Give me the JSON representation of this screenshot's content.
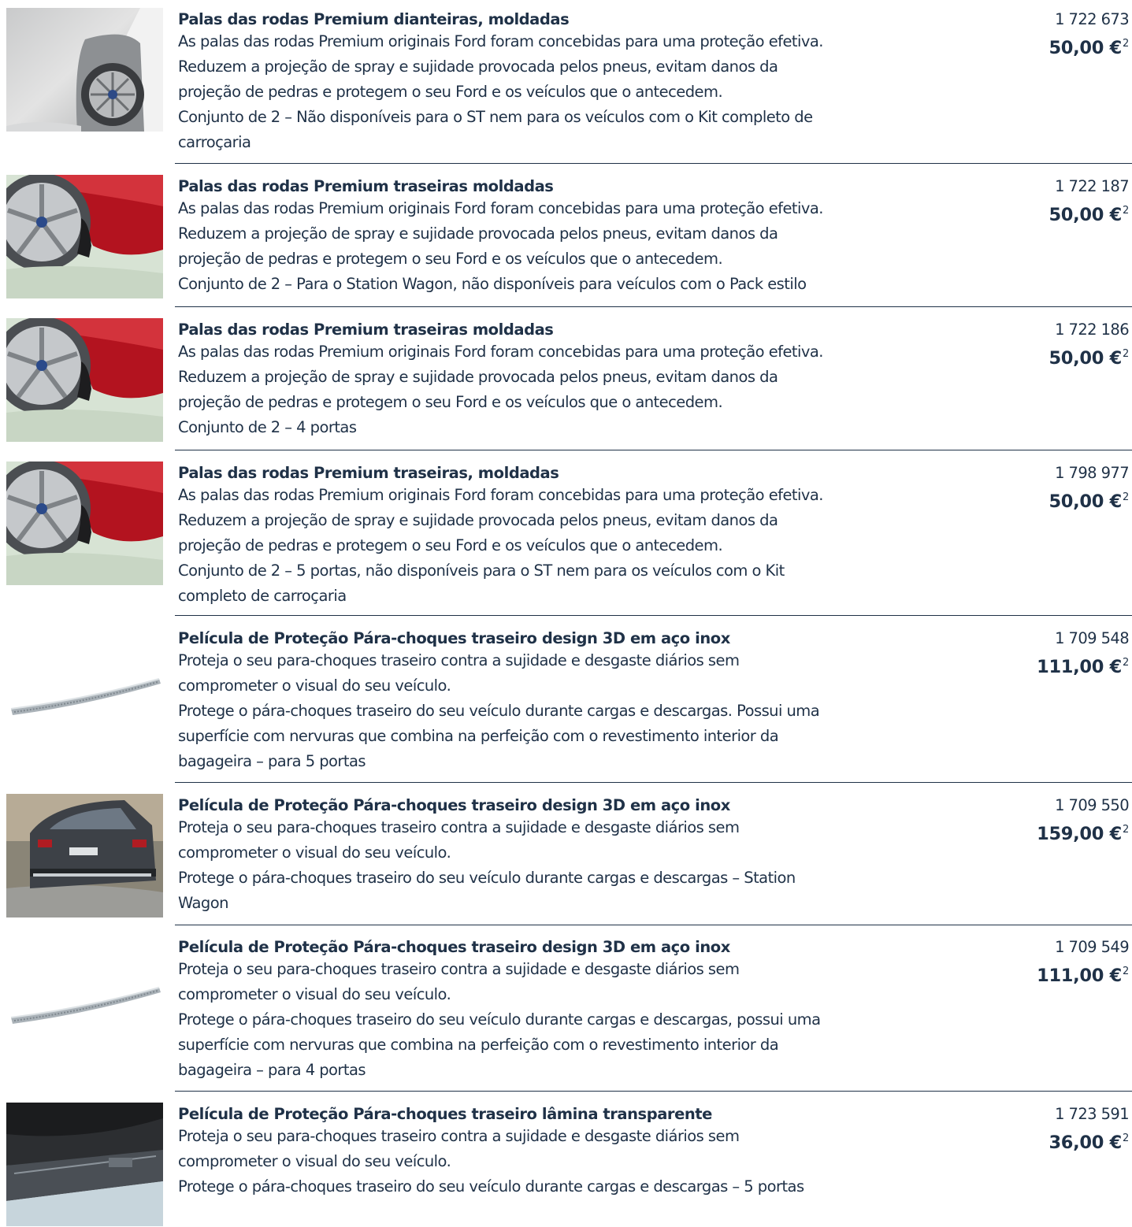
{
  "items": [
    {
      "title": "Palas das rodas Premium dianteiras, moldadas",
      "lines": [
        "As palas das rodas Premium originais Ford foram concebidas para uma proteção efetiva.",
        "Reduzem a projeção de spray e sujidade provocada pelos pneus, evitam danos da",
        "projeção de pedras e protegem o seu Ford e os veículos que o antecedem.",
        "Conjunto de 2 – Não disponíveis para o ST nem para os veículos com o Kit completo de",
        "carroçaria"
      ],
      "code": "1 722 673",
      "price": "50,00 €",
      "footnote": "2",
      "image": "front-wheel-mudflap-silver-car"
    },
    {
      "title": "Palas das rodas Premium traseiras moldadas",
      "lines": [
        "As palas das rodas Premium originais Ford foram concebidas para uma proteção efetiva.",
        "Reduzem a projeção de spray e sujidade provocada pelos pneus, evitam danos da",
        "projeção de pedras e protegem o seu Ford e os veículos que o antecedem.",
        "Conjunto de 2 – Para o Station Wagon, não disponíveis para veículos com o Pack estilo"
      ],
      "code": "1 722 187",
      "price": "50,00 €",
      "footnote": "2",
      "image": "rear-wheel-mudflap-red-car"
    },
    {
      "title": "Palas das rodas Premium traseiras moldadas",
      "lines": [
        "As palas das rodas Premium originais Ford foram concebidas para uma proteção efetiva.",
        "Reduzem a projeção de spray e sujidade provocada pelos pneus, evitam danos da",
        "projeção de pedras e protegem o seu Ford e os veículos que o antecedem.",
        "Conjunto de 2 – 4 portas"
      ],
      "code": "1 722 186",
      "price": "50,00 €",
      "footnote": "2",
      "image": "rear-wheel-mudflap-red-car"
    },
    {
      "title": "Palas das rodas Premium traseiras, moldadas",
      "lines": [
        "As palas das rodas Premium originais Ford foram concebidas para uma proteção efetiva.",
        "Reduzem a projeção de spray e sujidade provocada pelos pneus, evitam danos da",
        "projeção de pedras e protegem o seu Ford e os veículos que o antecedem.",
        "Conjunto de 2 – 5 portas, não disponíveis para o ST nem para os veículos com o Kit",
        "completo de carroçaria"
      ],
      "code": "1 798 977",
      "price": "50,00 €",
      "footnote": "2",
      "image": "rear-wheel-mudflap-red-car"
    },
    {
      "title": "Película de Proteção Pára-choques traseiro design 3D em aço inox",
      "lines": [
        "Proteja o seu para-choques traseiro contra a sujidade e desgaste diários sem",
        "comprometer o visual do seu veículo.",
        "Protege o pára-choques traseiro do seu veículo durante cargas e descargas. Possui uma",
        "superfície com nervuras que combina na perfeição com o revestimento interior da",
        "bagageira – para 5 portas"
      ],
      "code": "1 709 548",
      "price": "111,00 €",
      "footnote": "2",
      "image": "stainless-bumper-protector-strip"
    },
    {
      "title": "Película de Proteção Pára-choques traseiro design 3D em aço inox",
      "lines": [
        "Proteja o seu para-choques traseiro contra a sujidade e desgaste diários sem",
        "comprometer o visual do seu veículo.",
        "Protege o pára-choques traseiro do seu veículo durante cargas e descargas – Station",
        "Wagon"
      ],
      "code": "1 709 550",
      "price": "159,00 €",
      "footnote": "2",
      "image": "station-wagon-rear-view"
    },
    {
      "title": "Película de Proteção Pára-choques traseiro design 3D em aço inox",
      "lines": [
        "Proteja o seu para-choques traseiro contra a sujidade e desgaste diários sem",
        "comprometer o visual do seu veículo.",
        "Protege o pára-choques traseiro do seu veículo durante cargas e descargas, possui uma",
        "superfície com nervuras que combina na perfeição com o revestimento interior da",
        "bagageira – para 4 portas"
      ],
      "code": "1 709 549",
      "price": "111,00 €",
      "footnote": "2",
      "image": "stainless-bumper-protector-strip"
    },
    {
      "title": "Película de Proteção Pára-choques traseiro lâmina transparente",
      "lines": [
        "Proteja o seu para-choques traseiro contra a sujidade e desgaste diários sem",
        "comprometer o visual do seu veículo.",
        "Protege o pára-choques traseiro do seu veículo durante cargas e descargas – 5 portas"
      ],
      "code": "1 723 591",
      "price": "36,00 €",
      "footnote": "2",
      "image": "transparent-bumper-film-trunk"
    }
  ]
}
